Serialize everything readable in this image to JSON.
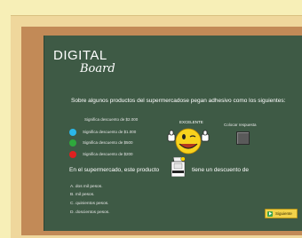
{
  "brand": {
    "main": "DIGITAL",
    "sub": "Board"
  },
  "question": {
    "text": "Sobre algunos productos del supermercadose pegan adhesivo como los siguientes:"
  },
  "legend": {
    "title": "Significa descuento de $2.000",
    "items": [
      {
        "color": "#2ab7ea",
        "label": "Significa descuento de $1.000"
      },
      {
        "color": "#2ea83c",
        "label": "Significa descuento de $500"
      },
      {
        "color": "#e02020",
        "label": "Significa descuento de $200"
      }
    ]
  },
  "feedback": {
    "label": "EXCELENTE"
  },
  "drop_zone": {
    "label": "Colocar respuesta"
  },
  "sentence": {
    "part1": "En el supermercado, este producto",
    "part2": "tiene un descuento de"
  },
  "options": [
    {
      "label": "A. dos mil pesos."
    },
    {
      "label": "B. mil pesos."
    },
    {
      "label": "C. quinientos pesos."
    },
    {
      "label": "D. doscientos pesos."
    }
  ],
  "next_button": {
    "label": "Siguiente"
  }
}
